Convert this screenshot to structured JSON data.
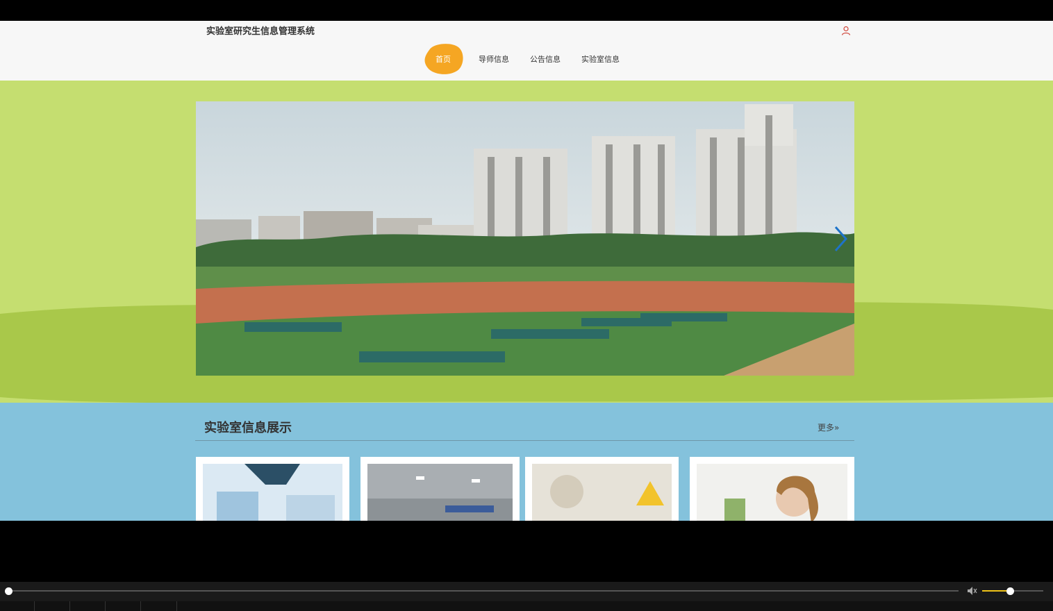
{
  "site": {
    "title": "实验室研究生信息管理系统"
  },
  "nav": {
    "items": [
      {
        "label": "首页",
        "active": true
      },
      {
        "label": "导师信息"
      },
      {
        "label": "公告信息"
      },
      {
        "label": "实验室信息"
      }
    ]
  },
  "icons": {
    "user": "user-icon",
    "banner_next": "chevron-right-icon",
    "more": "double-chevron-right-icon",
    "volume": "volume-icon"
  },
  "colors": {
    "nav_active": "#f5a623",
    "banner_bg": "#c5de70",
    "banner_band": "#a9c84a",
    "section_bg": "#84c2dc"
  },
  "lab_section": {
    "heading": "实验室信息展示",
    "more_label": "更多"
  },
  "player": {
    "progress": 0,
    "volume": 0.45
  }
}
